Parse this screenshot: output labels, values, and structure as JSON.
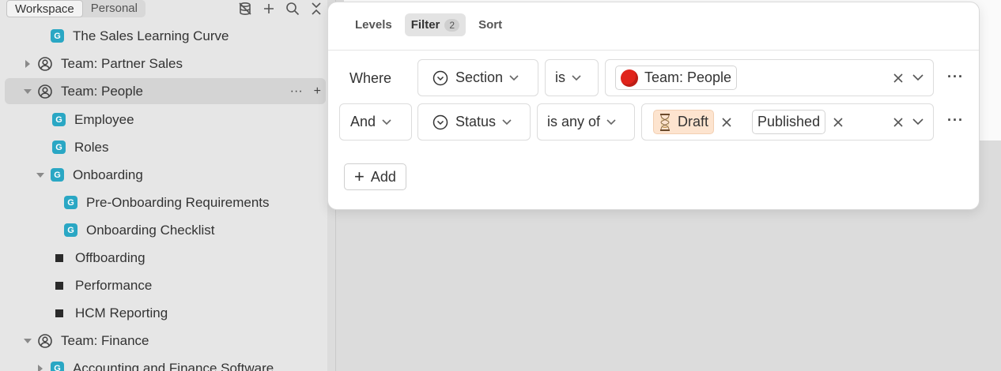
{
  "sidebar": {
    "tabs": [
      "Workspace",
      "Personal"
    ],
    "items": [
      {
        "label": "The Sales Learning Curve"
      },
      {
        "label": "Team: Partner Sales"
      },
      {
        "label": "Team: People"
      },
      {
        "label": "Employee"
      },
      {
        "label": "Roles"
      },
      {
        "label": "Onboarding"
      },
      {
        "label": "Pre-Onboarding Requirements"
      },
      {
        "label": "Onboarding Checklist"
      },
      {
        "label": "Offboarding"
      },
      {
        "label": "Performance"
      },
      {
        "label": "HCM Reporting"
      },
      {
        "label": "Team: Finance"
      },
      {
        "label": "Accounting and Finance Software"
      }
    ],
    "badge_letter": "G",
    "row_actions": {
      "more": "···",
      "add": "+"
    }
  },
  "popover": {
    "tabs": {
      "levels": "Levels",
      "filter": "Filter",
      "filter_count": "2",
      "sort": "Sort"
    },
    "row1": {
      "conjunction": "Where",
      "property": "Section",
      "operator": "is",
      "value": "Team: People"
    },
    "row2": {
      "conjunction": "And",
      "property": "Status",
      "operator": "is any of",
      "values": [
        "Draft",
        "Published"
      ]
    },
    "more_label": "···",
    "add_label": "Add"
  },
  "colors": {
    "badge": "#2aa7c4",
    "draft_chip": "#fde4cf",
    "red_dot": "#e0231b"
  }
}
